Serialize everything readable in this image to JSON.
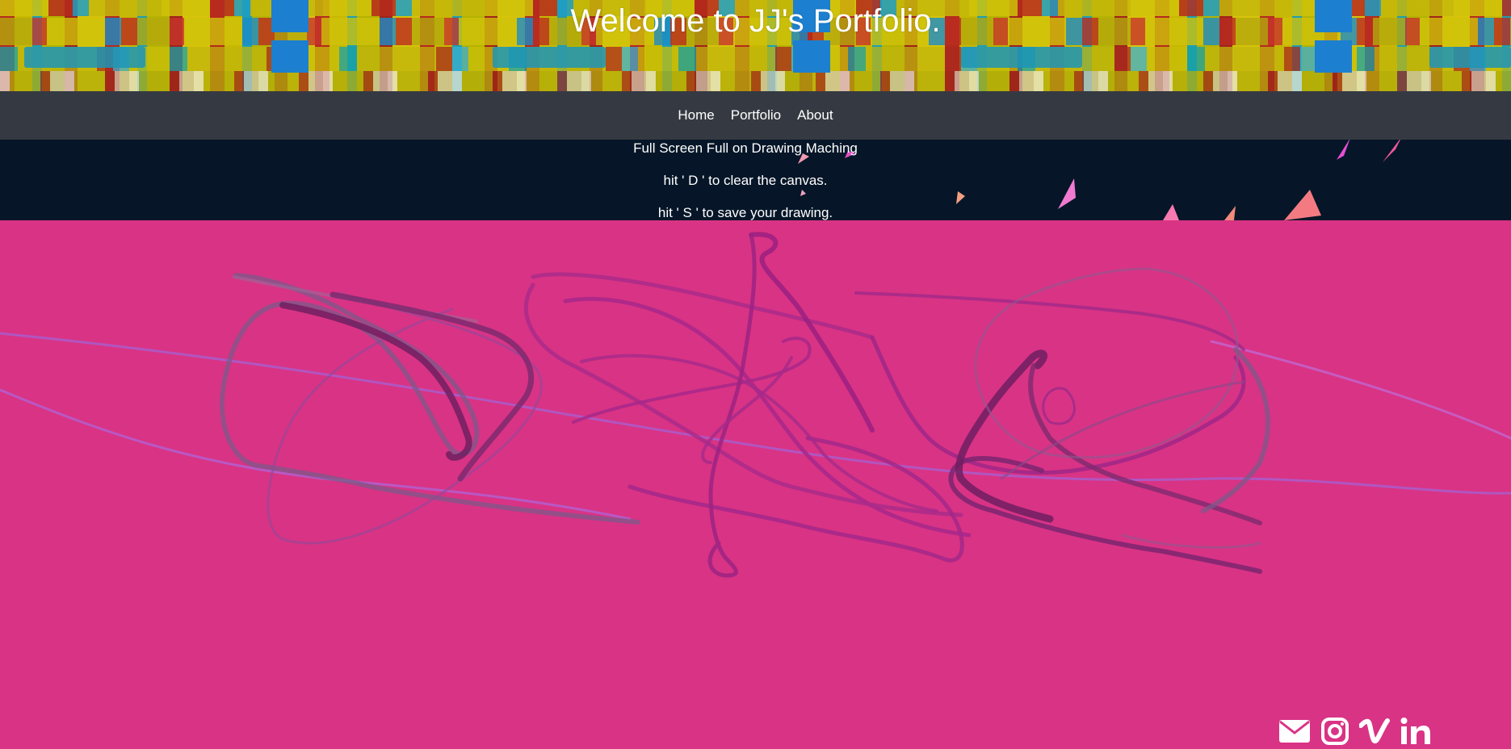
{
  "header": {
    "title": "Welcome to JJ's Portfolio."
  },
  "nav": {
    "items": [
      {
        "label": "Home"
      },
      {
        "label": "Portfolio"
      },
      {
        "label": "About"
      }
    ]
  },
  "info": {
    "line1": "Full Screen Full on Drawing Maching",
    "line2": "hit ' D ' to clear the canvas.",
    "line3": "hit ' S ' to save your drawing."
  },
  "social": {
    "icons": [
      "envelope-icon",
      "instagram-icon",
      "vimeo-icon",
      "linkedin-icon"
    ]
  },
  "colors": {
    "page_bg": "#d93385",
    "nav_bg": "#353a42",
    "info_bg": "#061628",
    "text": "#ffffff"
  }
}
